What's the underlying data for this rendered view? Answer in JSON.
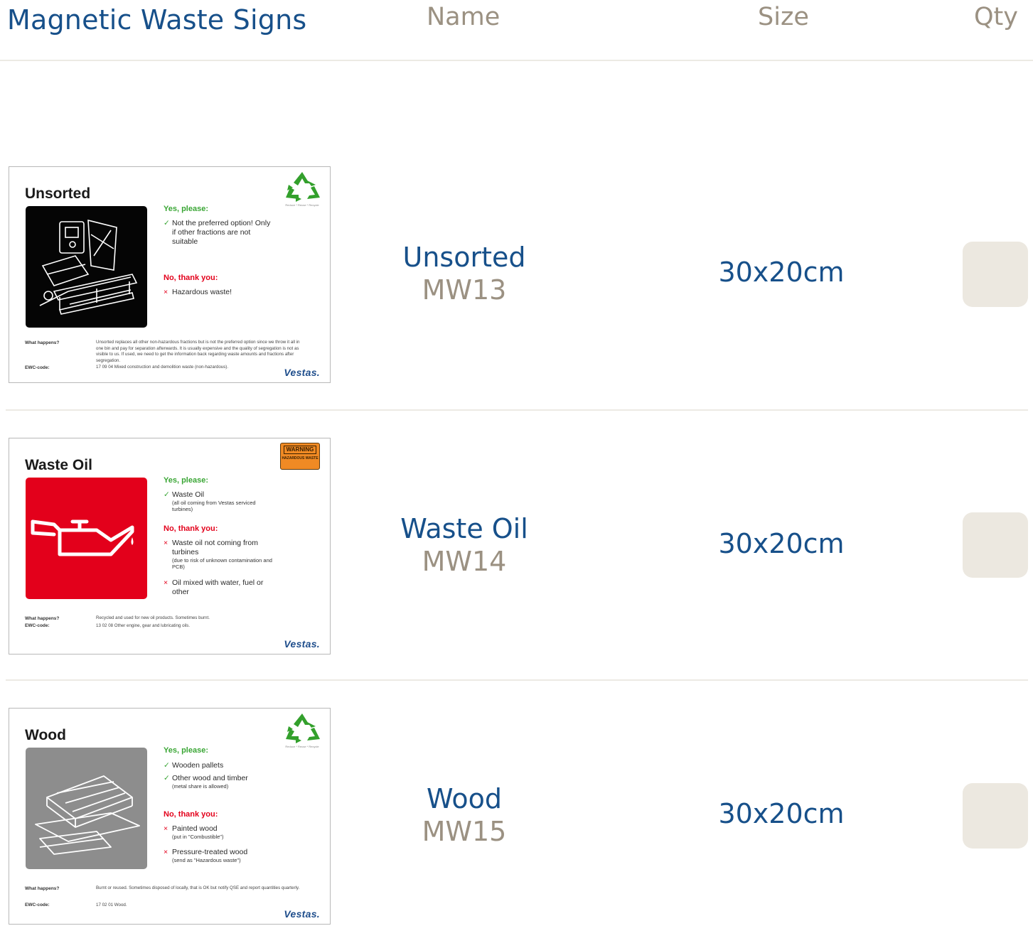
{
  "header": {
    "title": "Magnetic Waste Signs",
    "col_name": "Name",
    "col_size": "Size",
    "col_qty": "Qty"
  },
  "products": [
    {
      "name": "Unsorted",
      "code": "MW13",
      "size": "30x20cm",
      "qty_value": "",
      "sign": {
        "title": "Unsorted",
        "yes_heading": "Yes, please:",
        "yes_items": [
          "Not the preferred option! Only if other fractions are not suitable"
        ],
        "no_heading": "No, thank you:",
        "no_items": [
          "Hazardous waste!"
        ],
        "what_label": "What happens?",
        "ewc_label": "EWC-code:",
        "what_text": "Unsorted replaces all other non-hazardous fractions but is not the preferred option since we throw it all in one bin and pay for separation afterwards. It is usually expensive and the quality of segregation is not as visible to us. If used, we need to get the information back regarding waste amounts and fractions after segregation.",
        "ewc_text": "17 09 04 Mixed construction and demolition waste (non-hazardous).",
        "badge": "recycle-icon",
        "brand": "Vestas."
      }
    },
    {
      "name": "Waste Oil",
      "code": "MW14",
      "size": "30x20cm",
      "qty_value": "",
      "sign": {
        "title": "Waste Oil",
        "yes_heading": "Yes, please:",
        "yes_items": [
          "Waste Oil"
        ],
        "yes_subs": [
          "(all oil coming from Vestas serviced turbines)"
        ],
        "no_heading": "No, thank you:",
        "no_items": [
          "Waste oil not coming from turbines",
          "Oil mixed with water, fuel or other"
        ],
        "no_subs": [
          "(due to risk of unknown contamination and PCB)",
          ""
        ],
        "what_label": "What happens?",
        "ewc_label": "EWC-code:",
        "what_text": "Recycled and used for new oil products. Sometimes burnt.",
        "ewc_text": "13 02 08 Other engine, gear and lubricating oils.",
        "badge_top": "WARNING",
        "badge_bottom": "HAZARDOUS WASTE",
        "brand": "Vestas."
      }
    },
    {
      "name": "Wood",
      "code": "MW15",
      "size": "30x20cm",
      "qty_value": "",
      "sign": {
        "title": "Wood",
        "yes_heading": "Yes, please:",
        "yes_items": [
          "Wooden pallets",
          "Other wood and timber"
        ],
        "yes_subs": [
          "",
          "(metal share is allowed)"
        ],
        "no_heading": "No, thank you:",
        "no_items": [
          "Painted wood",
          "Pressure-treated wood"
        ],
        "no_subs": [
          "(put in \"Combustible\")",
          "(send as \"Hazardous waste\")"
        ],
        "what_label": "What happens?",
        "ewc_label": "EWC-code:",
        "what_text": "Burnt or reused. Sometimes disposed of locally, that is OK but notify QSE and report quantities quarterly.",
        "ewc_text": "17 02 01 Wood.",
        "badge": "recycle-icon",
        "brand": "Vestas."
      }
    }
  ],
  "colors": {
    "brand_blue": "#17508a",
    "muted": "#9b9182",
    "qty_bg": "#ece8e0",
    "yes_green": "#3aa635",
    "no_red": "#e3001b"
  }
}
